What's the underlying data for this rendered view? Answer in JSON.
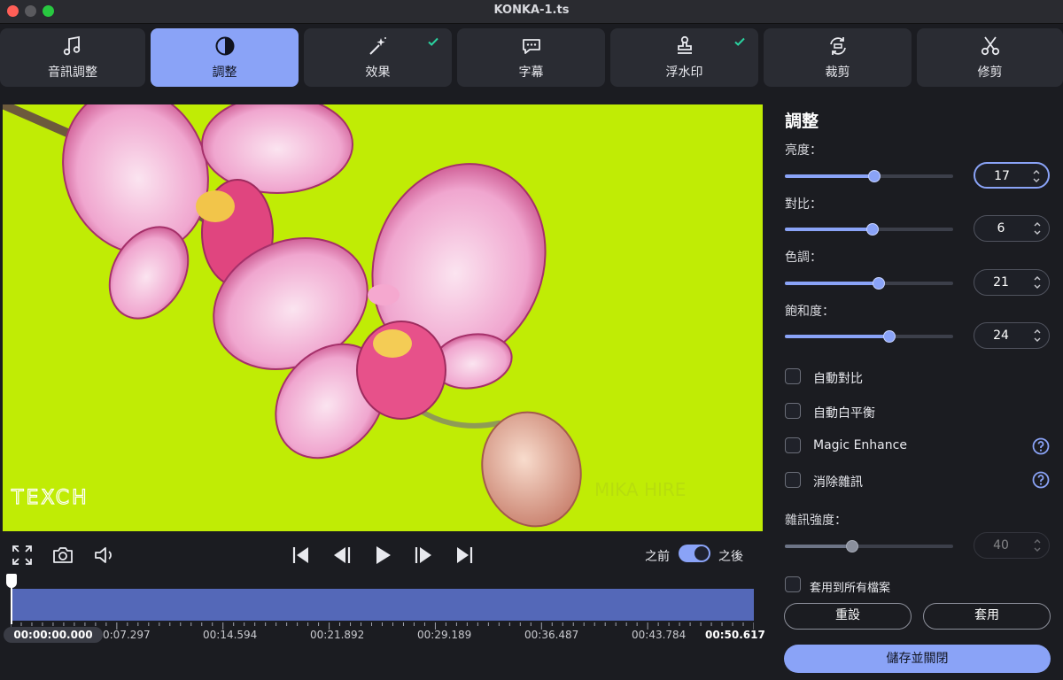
{
  "window": {
    "title": "KONKA-1.ts"
  },
  "tabs": [
    {
      "label": "音訊調整",
      "icon": "music-note-icon",
      "active": false,
      "checked": false
    },
    {
      "label": "調整",
      "icon": "contrast-icon",
      "active": true,
      "checked": false
    },
    {
      "label": "效果",
      "icon": "magic-wand-icon",
      "active": false,
      "checked": true
    },
    {
      "label": "字幕",
      "icon": "speech-bubble-icon",
      "active": false,
      "checked": false
    },
    {
      "label": "浮水印",
      "icon": "stamp-icon",
      "active": false,
      "checked": true
    },
    {
      "label": "裁剪",
      "icon": "crop-rotate-icon",
      "active": false,
      "checked": false
    },
    {
      "label": "修剪",
      "icon": "scissors-icon",
      "active": false,
      "checked": false
    }
  ],
  "preview": {
    "watermark_text": "TEXCH",
    "overlay_text": "MIKA HIRE"
  },
  "controls": {
    "before_label": "之前",
    "after_label": "之後",
    "after_enabled": true
  },
  "timeline": {
    "current_time": "00:00:00.000",
    "labels": [
      "0:07.297",
      "00:14.594",
      "00:21.892",
      "00:29.189",
      "00:36.487",
      "00:43.784",
      "00:50.617"
    ],
    "playhead_fraction": 0
  },
  "panel": {
    "title": "調整",
    "sliders": [
      {
        "label": "亮度：",
        "value": "17",
        "fraction": 0.53
      },
      {
        "label": "對比：",
        "value": "6",
        "fraction": 0.52
      },
      {
        "label": "色調：",
        "value": "21",
        "fraction": 0.56
      },
      {
        "label": "飽和度：",
        "value": "24",
        "fraction": 0.62
      }
    ],
    "checkboxes": [
      {
        "label": "自動對比",
        "checked": false,
        "help": false
      },
      {
        "label": "自動白平衡",
        "checked": false,
        "help": false
      },
      {
        "label": "Magic Enhance",
        "checked": false,
        "help": true
      },
      {
        "label": "消除雜訊",
        "checked": false,
        "help": true
      }
    ],
    "noise": {
      "label": "雜訊強度：",
      "value": "40",
      "fraction": 0.4,
      "enabled": false
    },
    "apply_all_label": "套用到所有檔案",
    "reset_label": "重設",
    "apply_label": "套用",
    "save_close_label": "儲存並關閉"
  },
  "colors": {
    "accent": "#8aa3f7",
    "preview_bg": "#c0ec05",
    "track": "#5468b8",
    "check": "#2ad3a0"
  }
}
